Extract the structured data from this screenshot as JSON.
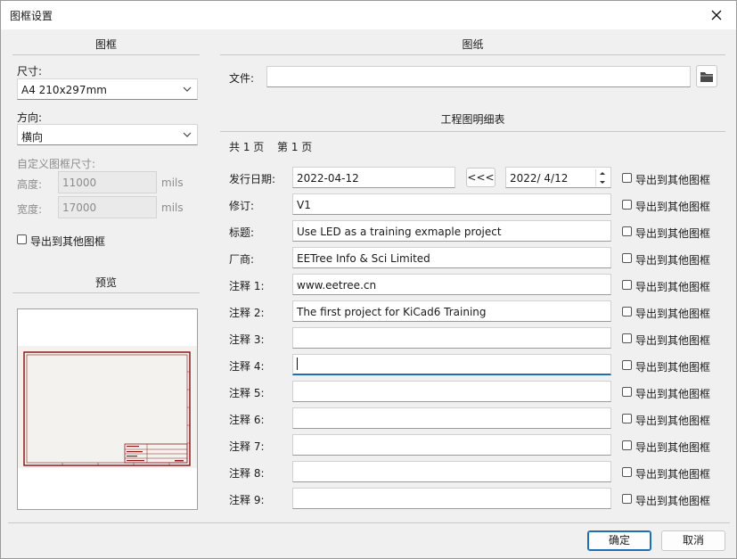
{
  "window": {
    "title": "图框设置"
  },
  "left": {
    "section_title": "图框",
    "size_label": "尺寸:",
    "size_value": "A4 210x297mm",
    "orientation_label": "方向:",
    "orientation_value": "横向",
    "custom_size_label": "自定义图框尺寸:",
    "height_label": "高度:",
    "height_value": "11000",
    "height_unit": "mils",
    "width_label": "宽度:",
    "width_value": "17000",
    "width_unit": "mils",
    "export_label": "导出到其他图框",
    "preview_title": "预览"
  },
  "right": {
    "section_title": "图纸",
    "file_label": "文件:",
    "file_value": "",
    "title_block_title": "工程图明细表",
    "total_pages": "共 1 页",
    "page_number": "第 1 页",
    "issue_date_label": "发行日期:",
    "issue_date_value": "2022-04-12",
    "copy_date_button": "<<<",
    "date_picker_value": "2022/  4/12",
    "export_label": "导出到其他图框",
    "fields": [
      {
        "label": "修订:",
        "value": "V1"
      },
      {
        "label": "标题:",
        "value": "Use LED as a training exmaple project"
      },
      {
        "label": "厂商:",
        "value": "EETree Info & Sci Limited"
      },
      {
        "label": "注释 1:",
        "value": "www.eetree.cn"
      },
      {
        "label": "注释 2:",
        "value": "The first project for KiCad6 Training"
      },
      {
        "label": "注释 3:",
        "value": ""
      },
      {
        "label": "注释 4:",
        "value": ""
      },
      {
        "label": "注释 5:",
        "value": ""
      },
      {
        "label": "注释 6:",
        "value": ""
      },
      {
        "label": "注释 7:",
        "value": ""
      },
      {
        "label": "注释 8:",
        "value": ""
      },
      {
        "label": "注释 9:",
        "value": ""
      }
    ]
  },
  "buttons": {
    "ok": "确定",
    "cancel": "取消"
  }
}
